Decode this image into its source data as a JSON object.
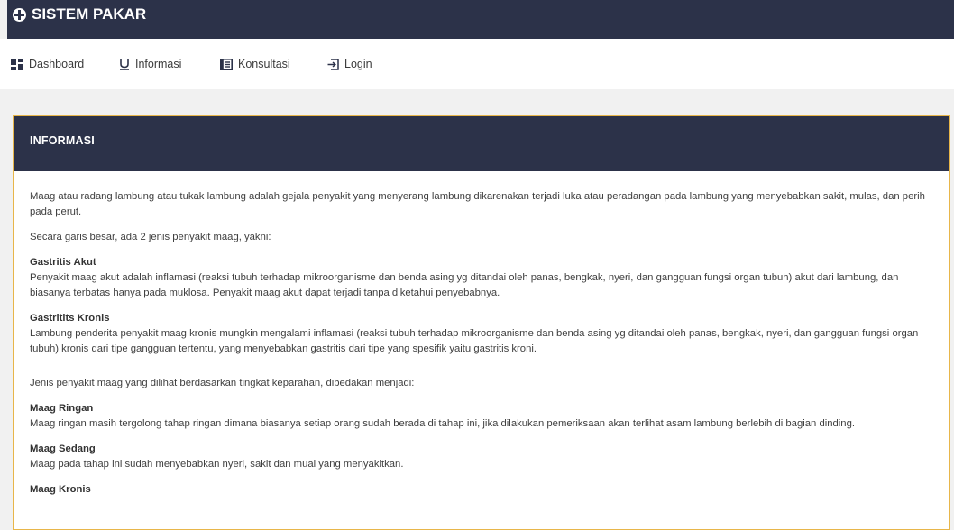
{
  "app": {
    "title": "SISTEM PAKAR",
    "brand_icon": "plus-circle-icon"
  },
  "nav": [
    {
      "label": "Dashboard",
      "icon": "dashboard-icon"
    },
    {
      "label": "Informasi",
      "icon": "u-icon"
    },
    {
      "label": "Konsultasi",
      "icon": "book-icon"
    },
    {
      "label": "Login",
      "icon": "login-icon"
    }
  ],
  "panel": {
    "header": "INFORMASI",
    "intro": "Maag atau radang lambung atau tukak lambung adalah gejala penyakit yang menyerang lambung dikarenakan terjadi luka atau peradangan pada lambung yang menyebabkan sakit, mulas, dan perih pada perut.",
    "types_intro": "Secara garis besar, ada 2 jenis penyakit maag, yakni:",
    "types": [
      {
        "title": "Gastritis Akut",
        "text": "Penyakit maag akut adalah inflamasi (reaksi tubuh terhadap mikroorganisme dan benda asing yg ditandai oleh panas, bengkak, nyeri, dan gangguan fungsi organ tubuh) akut dari lambung, dan biasanya terbatas hanya pada muklosa. Penyakit maag akut dapat terjadi tanpa diketahui penyebabnya."
      },
      {
        "title": "Gastritits Kronis",
        "text": "Lambung penderita penyakit maag kronis mungkin mengalami inflamasi (reaksi tubuh terhadap mikroorganisme dan benda asing yg ditandai oleh panas, bengkak, nyeri, dan gangguan fungsi organ tubuh) kronis dari tipe gangguan tertentu, yang menyebabkan gastritis dari tipe yang spesifik yaitu gastritis kroni."
      }
    ],
    "levels_intro": "Jenis penyakit maag yang dilihat berdasarkan tingkat keparahan, dibedakan menjadi:",
    "levels": [
      {
        "title": "Maag Ringan",
        "text": "Maag ringan masih tergolong tahap ringan dimana biasanya setiap orang sudah berada di tahap ini, jika dilakukan pemeriksaan akan terlihat asam lambung berlebih di bagian dinding."
      },
      {
        "title": "Maag Sedang",
        "text": "Maag pada tahap ini sudah menyebabkan nyeri, sakit dan mual yang menyakitkan."
      },
      {
        "title": "Maag Kronis",
        "text": ""
      }
    ]
  }
}
